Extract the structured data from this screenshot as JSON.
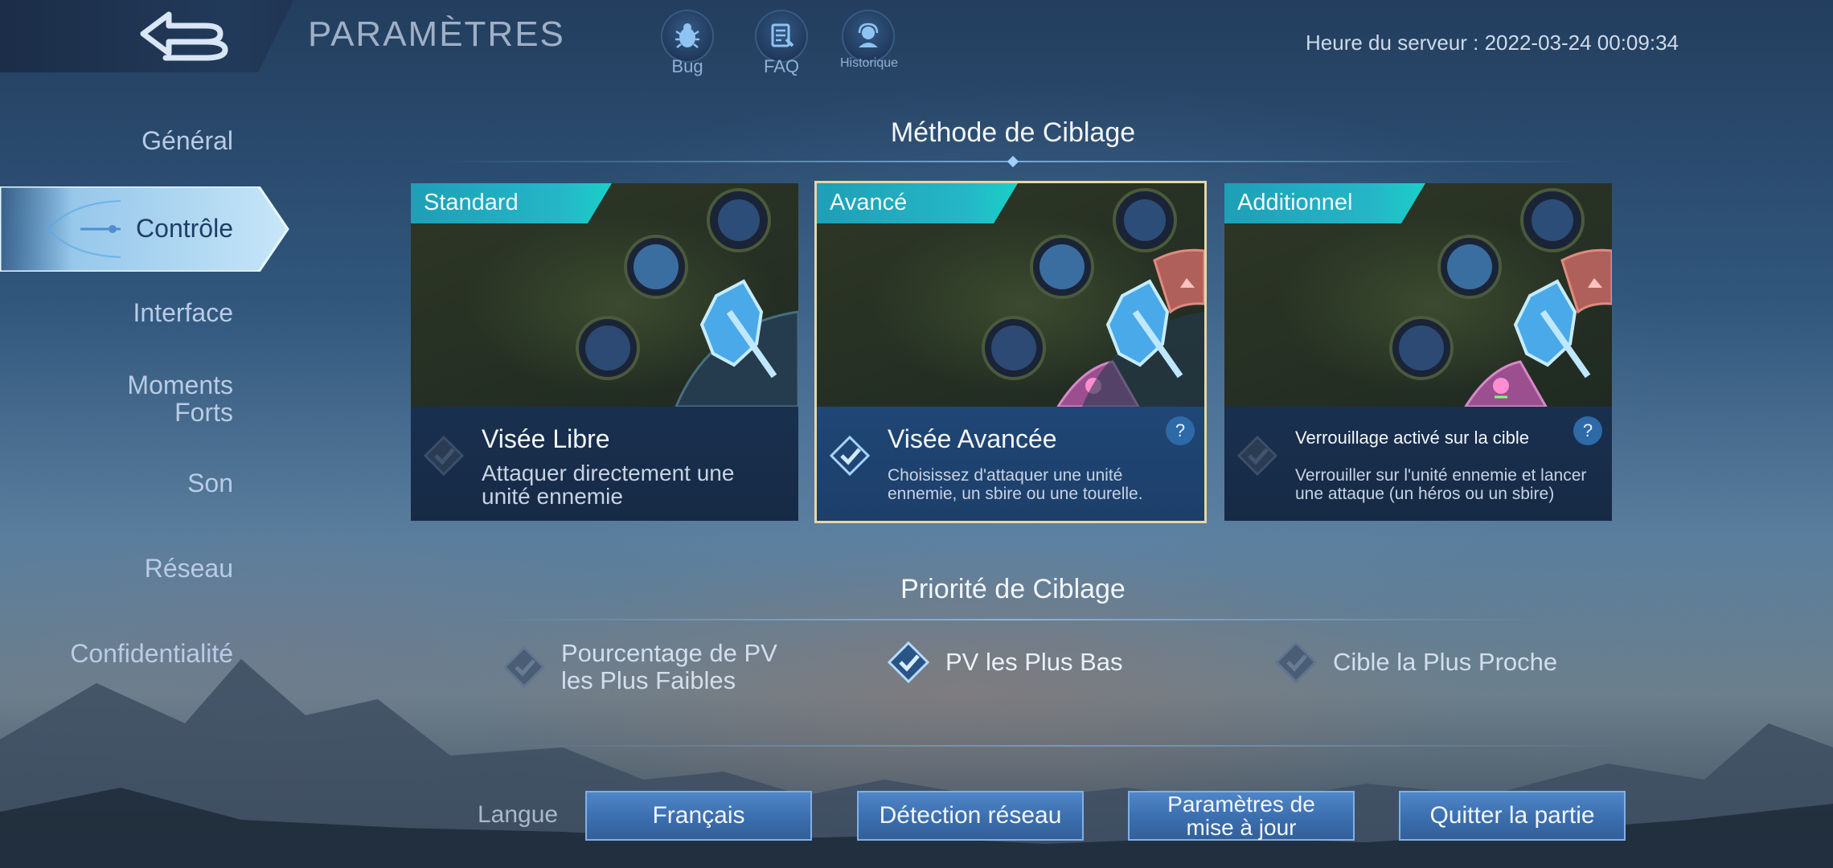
{
  "header": {
    "title": "PARAMÈTRES",
    "icons": [
      {
        "name": "bug-icon",
        "label": "Bug"
      },
      {
        "name": "faq-icon",
        "label": "FAQ"
      },
      {
        "name": "history-icon",
        "label": "Historique"
      }
    ],
    "server_time": "Heure du serveur : 2022-03-24 00:09:34"
  },
  "sidebar": {
    "items": [
      {
        "label": "Général"
      },
      {
        "label": "Contrôle",
        "active": true
      },
      {
        "label": "Interface"
      },
      {
        "label": "Moments Forts",
        "line1": "Moments",
        "line2": "Forts"
      },
      {
        "label": "Son"
      },
      {
        "label": "Réseau"
      },
      {
        "label": "Confidentialité"
      }
    ]
  },
  "targeting_method": {
    "title": "Méthode de Ciblage",
    "cards": [
      {
        "tag": "Standard",
        "title": "Visée Libre",
        "description": "Attaquer directement une unité ennemie",
        "selected": false,
        "help": ""
      },
      {
        "tag": "Avancé",
        "title": "Visée Avancée",
        "description": "Choisissez d'attaquer une unité ennemie, un sbire ou une tourelle.",
        "selected": true,
        "help": "?"
      },
      {
        "tag": "Additionnel",
        "title": "Verrouillage activé sur la cible",
        "description": "Verrouiller sur l'unité ennemie et lancer une attaque (un héros ou un sbire)",
        "selected": false,
        "help": "?"
      }
    ]
  },
  "targeting_priority": {
    "title": "Priorité de Ciblage",
    "options": [
      {
        "label_line1": "Pourcentage de PV",
        "label_line2": "les Plus Faibles",
        "selected": false
      },
      {
        "label": "PV les Plus Bas",
        "selected": true
      },
      {
        "label": "Cible la Plus Proche",
        "selected": false
      }
    ]
  },
  "footer": {
    "language_label": "Langue",
    "buttons": [
      {
        "label": "Français"
      },
      {
        "label": "Détection réseau"
      },
      {
        "label_line1": "Paramètres de",
        "label_line2": "mise à jour"
      },
      {
        "label": "Quitter la partie"
      }
    ]
  },
  "colors": {
    "accent_teal": "#24b7c7",
    "selected_border": "#e7d6a6",
    "button_blue": "#3b6eae"
  }
}
